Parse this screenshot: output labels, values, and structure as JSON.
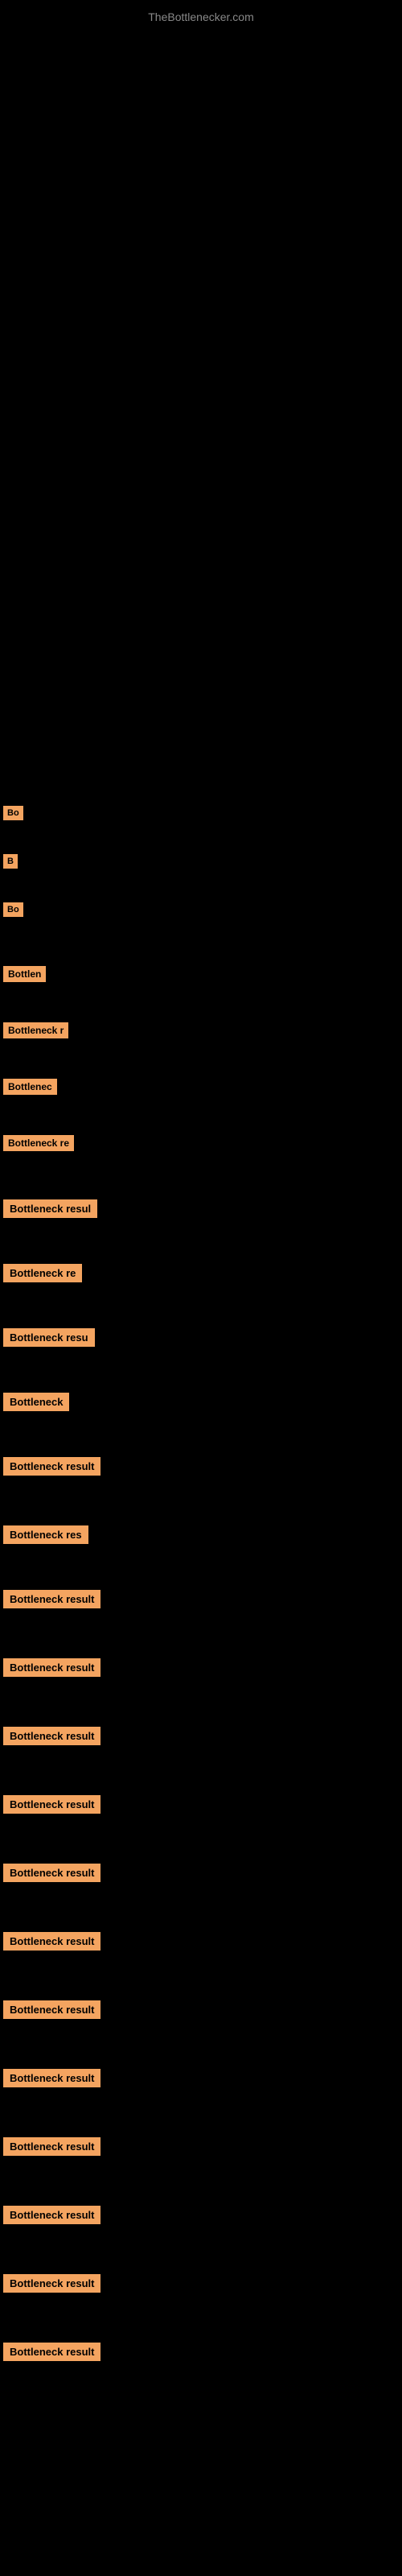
{
  "site": {
    "title": "TheBottlenecker.com"
  },
  "items": [
    {
      "id": 1,
      "label": "Bo",
      "class": "item-1"
    },
    {
      "id": 2,
      "label": "B",
      "class": "item-2"
    },
    {
      "id": 3,
      "label": "Bo",
      "class": "item-3"
    },
    {
      "id": 4,
      "label": "Bottlen",
      "class": "item-4"
    },
    {
      "id": 5,
      "label": "Bottleneck r",
      "class": "item-5"
    },
    {
      "id": 6,
      "label": "Bottlenec",
      "class": "item-6"
    },
    {
      "id": 7,
      "label": "Bottleneck re",
      "class": "item-7"
    },
    {
      "id": 8,
      "label": "Bottleneck resul",
      "class": "item-8"
    },
    {
      "id": 9,
      "label": "Bottleneck re",
      "class": "item-9"
    },
    {
      "id": 10,
      "label": "Bottleneck resu",
      "class": "item-10"
    },
    {
      "id": 11,
      "label": "Bottleneck",
      "class": "item-11"
    },
    {
      "id": 12,
      "label": "Bottleneck result",
      "class": "item-12"
    },
    {
      "id": 13,
      "label": "Bottleneck res",
      "class": "item-13"
    },
    {
      "id": 14,
      "label": "Bottleneck result",
      "class": "item-14"
    },
    {
      "id": 15,
      "label": "Bottleneck result",
      "class": "item-15"
    },
    {
      "id": 16,
      "label": "Bottleneck result",
      "class": "item-16"
    },
    {
      "id": 17,
      "label": "Bottleneck result",
      "class": "item-17"
    },
    {
      "id": 18,
      "label": "Bottleneck result",
      "class": "item-18"
    },
    {
      "id": 19,
      "label": "Bottleneck result",
      "class": "item-19"
    },
    {
      "id": 20,
      "label": "Bottleneck result",
      "class": "item-20"
    },
    {
      "id": 21,
      "label": "Bottleneck result",
      "class": "item-21"
    },
    {
      "id": 22,
      "label": "Bottleneck result",
      "class": "item-22"
    },
    {
      "id": 23,
      "label": "Bottleneck result",
      "class": "item-23"
    },
    {
      "id": 24,
      "label": "Bottleneck result",
      "class": "item-24"
    },
    {
      "id": 25,
      "label": "Bottleneck result",
      "class": "item-25"
    }
  ],
  "colors": {
    "background": "#000000",
    "label_bg": "#F4A460",
    "label_text": "#000000",
    "site_title": "#888888"
  }
}
